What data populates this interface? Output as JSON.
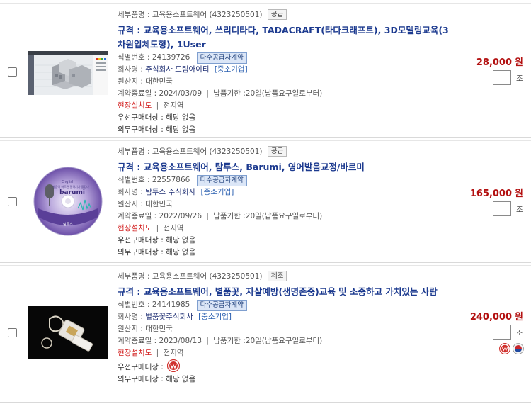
{
  "products": [
    {
      "category_label": "세부품명 : 교육용소프트웨어",
      "category_code": "(4323250501)",
      "supply_type": "공급",
      "spec_title": "규격 : 교육용소프트웨어, 쓰리디타다, TADACRAFT(타다크래프트), 3D모델링교육(3차원입체도형), 1User",
      "id_label": "식별번호 :",
      "id_value": "24139726",
      "contract_badge": "다수공급자계약",
      "company_label": "회사명 :",
      "company": "주식회사 드림아이티",
      "company_size": "[중소기업]",
      "origin": "원산지 : 대한민국",
      "contract_end": "계약종료일 : 2024/03/09",
      "delivery": "납품기한 :20일(납품요구일로부터)",
      "install_label": "현장설치도",
      "install_region": "전지역",
      "priority_purchase": "우선구매대상 : 해당 없음",
      "mandatory_purchase": "의무구매대상 : 해당 없음",
      "price": "28,000",
      "currency": "원",
      "qty_unit": "조"
    },
    {
      "category_label": "세부품명 : 교육용소프트웨어",
      "category_code": "(4323250501)",
      "supply_type": "공급",
      "spec_title": "규격 : 교육용소프트웨어, 탐투스, Barumi, 영어발음교정/바르미",
      "id_label": "식별번호 :",
      "id_value": "22557866",
      "contract_badge": "다수공급자계약",
      "company_label": "회사명 :",
      "company": "탐투스 주식회사",
      "company_size": "[중소기업]",
      "origin": "원산지 : 대한민국",
      "contract_end": "계약종료일 : 2022/09/26",
      "delivery": "납품기한 :20일(납품요구일로부터)",
      "install_label": "현장설치도",
      "install_region": "전지역",
      "priority_purchase": "우선구매대상 : 해당 없음",
      "mandatory_purchase": "의무구매대상 : 해당 없음",
      "price": "165,000",
      "currency": "원",
      "qty_unit": "조",
      "cd_label_small": "English",
      "cd_label_kr": "발음이 바르면 말하기가 즐겁다",
      "cd_label_brand": "barumi",
      "cd_label_footer": "탐투스"
    },
    {
      "category_label": "세부품명 : 교육용소프트웨어",
      "category_code": "(4323250501)",
      "supply_type": "제조",
      "spec_title": "규격 : 교육용소프트웨어, 별품꽃, 자살예방(생명존중)교육 및 소중하고 가치있는 사람",
      "id_label": "식별번호 :",
      "id_value": "24141985",
      "contract_badge": "다수공급자계약",
      "company_label": "회사명 :",
      "company": "별품꽃주식회사",
      "company_size": "[중소기업]",
      "origin": "원산지 : 대한민국",
      "contract_end": "계약종료일 : 2023/08/13",
      "delivery": "납품기한 :20일(납품요구일로부터)",
      "install_label": "현장설치도",
      "install_region": "전지역",
      "priority_purchase_label": "우선구매대상 :",
      "mandatory_purchase": "의무구매대상 : 해당 없음",
      "price": "240,000",
      "currency": "원",
      "qty_unit": "조"
    }
  ],
  "colors": {
    "title": "#1c3a8f",
    "price": "#b31111",
    "install": "#d21f1f",
    "badge_bg": "#dbe6f7"
  }
}
